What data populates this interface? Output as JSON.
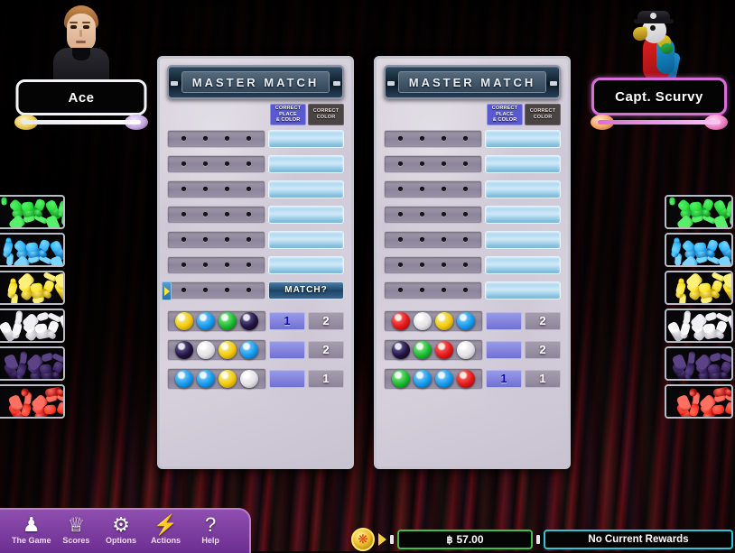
{
  "game": {
    "title": "Master Match"
  },
  "players": {
    "left": {
      "name": "Ace",
      "avatar": "man-portrait"
    },
    "right": {
      "name": "Capt. Scurvy",
      "avatar": "parrot-portrait"
    }
  },
  "palette": {
    "colors": [
      "green",
      "blue",
      "yellow",
      "white",
      "purple",
      "red"
    ],
    "hex": {
      "green": "#18b82e",
      "blue": "#1598ea",
      "yellow": "#f0c808",
      "white": "#e2e2e6",
      "purple": "#22123f",
      "red": "#e01818"
    }
  },
  "headers": {
    "correct_place_color": "CORRECT PLACE & COLOR",
    "correct_place_color_lines": [
      "CORRECT",
      "PLACE",
      "& COLOR"
    ],
    "correct_color": "CORRECT COLOR",
    "correct_color_lines": [
      "CORRECT",
      "COLOR"
    ]
  },
  "boards": [
    {
      "id": "board-left",
      "owner": "Ace",
      "title": "MASTER MATCH",
      "empty_rows": 6,
      "active_row": {
        "has_cursor": true,
        "button_label": "MATCH?",
        "pegs": [
          null,
          null,
          null,
          null
        ]
      },
      "guesses": [
        {
          "pegs": [
            "yellow",
            "blue",
            "green",
            "purple"
          ],
          "correct_place_color": "1",
          "correct_color": "2"
        },
        {
          "pegs": [
            "purple",
            "white",
            "yellow",
            "blue"
          ],
          "correct_place_color": "",
          "correct_color": "2"
        },
        {
          "pegs": [
            "blue",
            "blue",
            "yellow",
            "white"
          ],
          "correct_place_color": "",
          "correct_color": "1"
        }
      ]
    },
    {
      "id": "board-right",
      "owner": "Capt. Scurvy",
      "title": "MASTER MATCH",
      "empty_rows": 7,
      "active_row": null,
      "guesses": [
        {
          "pegs": [
            "red",
            "white",
            "yellow",
            "blue"
          ],
          "correct_place_color": "",
          "correct_color": "2"
        },
        {
          "pegs": [
            "purple",
            "green",
            "red",
            "white"
          ],
          "correct_place_color": "",
          "correct_color": "2"
        },
        {
          "pegs": [
            "green",
            "blue",
            "blue",
            "red"
          ],
          "correct_place_color": "1",
          "correct_color": "1"
        }
      ]
    }
  ],
  "toolbar": {
    "items": [
      {
        "icon": "person-icon",
        "label": "The Game"
      },
      {
        "icon": "trophy-icon",
        "label": "Scores"
      },
      {
        "icon": "gear-icon",
        "label": "Options"
      },
      {
        "icon": "lightning-icon",
        "label": "Actions"
      },
      {
        "icon": "question-icon",
        "label": "Help"
      }
    ]
  },
  "status": {
    "coin_icon": "token-icon",
    "currency_symbol": "฿",
    "balance": "57.00",
    "rewards": "No Current Rewards"
  }
}
